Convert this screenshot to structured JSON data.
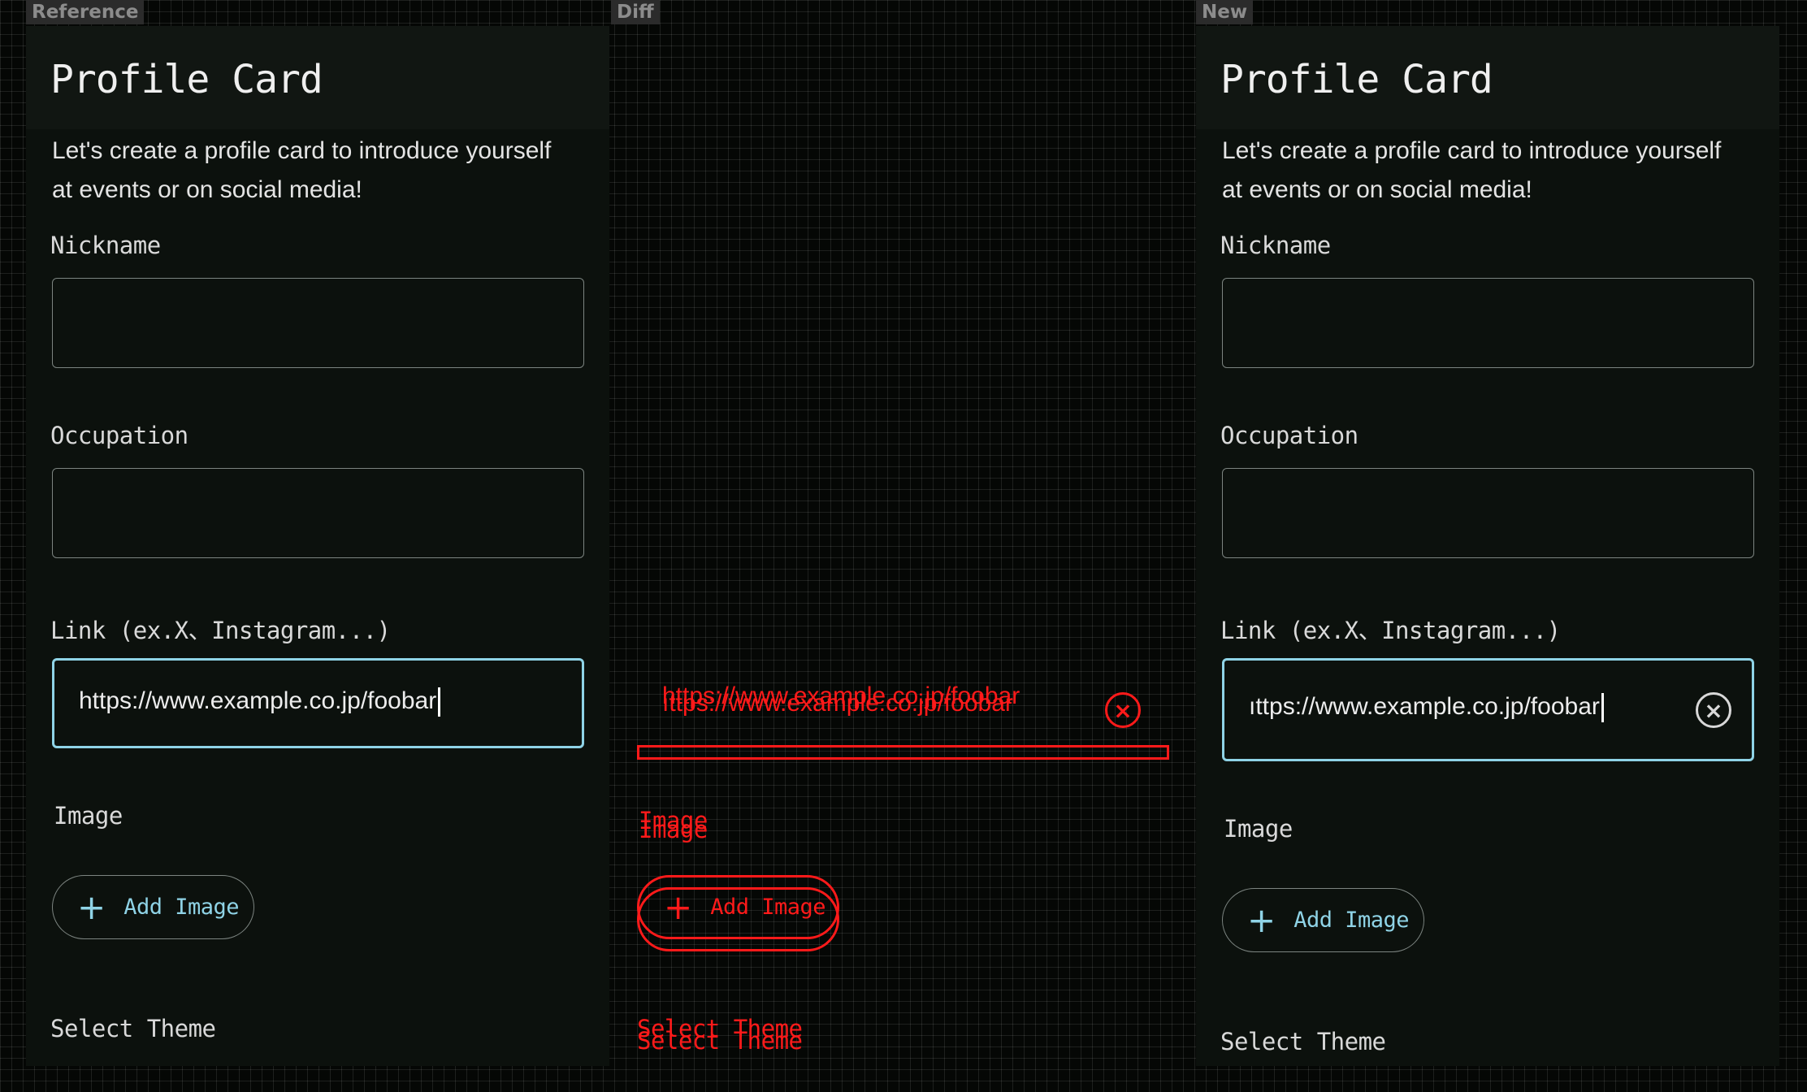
{
  "tags": {
    "reference": "Reference",
    "diff": "Diff",
    "new": "New"
  },
  "colors": {
    "accent": "#8fd3e6",
    "diff": "#ff1a1a",
    "panel": "#0c110d"
  },
  "form": {
    "title": "Profile Card",
    "intro": "Let's create a profile card to introduce yourself at events or on social media!",
    "nickname_label": "Nickname",
    "occupation_label": "Occupation",
    "link_label": "Link (ex.X、Instagram...)",
    "link_value": "https://www.example.co.jp/foobar",
    "link_value_scrolled": "ıttps://www.example.co.jp/foobar",
    "image_label": "Image",
    "add_image_label": "Add Image",
    "add_icon": "+",
    "clear_icon": "×",
    "theme_label": "Select Theme"
  }
}
